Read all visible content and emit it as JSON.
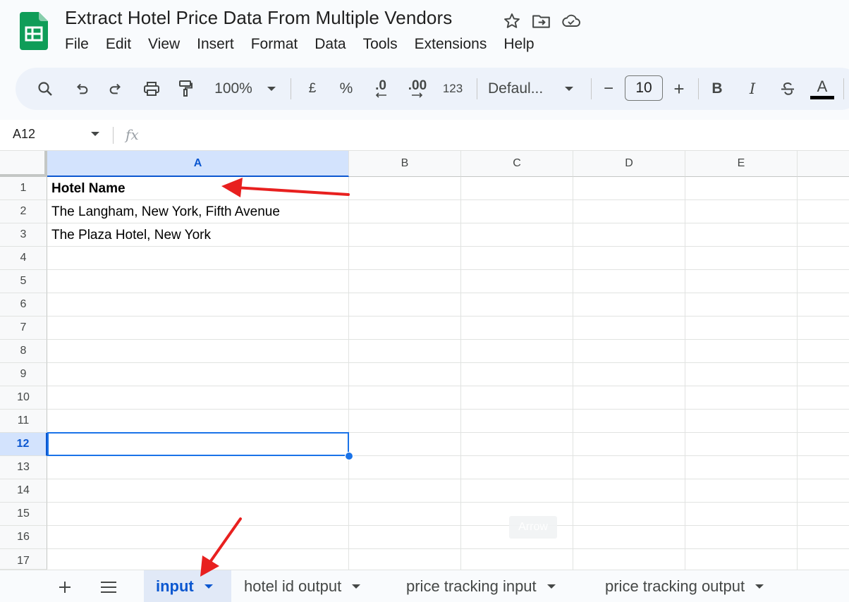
{
  "document": {
    "title": "Extract Hotel Price Data From Multiple Vendors"
  },
  "title_icons": [
    "star-icon",
    "move-folder-icon",
    "cloud-status-icon"
  ],
  "menu": [
    "File",
    "Edit",
    "View",
    "Insert",
    "Format",
    "Data",
    "Tools",
    "Extensions",
    "Help"
  ],
  "toolbar": {
    "zoom": "100%",
    "currency": "£",
    "percent": "%",
    "decrease_decimal": ".0",
    "increase_decimal": ".00",
    "number_format": "123",
    "font": "Defaul...",
    "font_size": "10",
    "minus": "−",
    "plus": "+",
    "bold": "B",
    "italic": "I",
    "text_color": "A"
  },
  "formula_bar": {
    "cell_ref": "A12",
    "fx": "fx",
    "value": ""
  },
  "grid": {
    "columns": [
      "A",
      "B",
      "C",
      "D",
      "E"
    ],
    "rows": [
      "1",
      "2",
      "3",
      "4",
      "5",
      "6",
      "7",
      "8",
      "9",
      "10",
      "11",
      "12",
      "13",
      "14",
      "15",
      "16",
      "17"
    ],
    "selected_column": "A",
    "selected_row": "12",
    "cells": {
      "A1": "Hotel Name",
      "A2": "The Langham, New York, Fifth Avenue",
      "A3": "The Plaza Hotel, New York"
    },
    "watermark": "Arrow"
  },
  "sheet_tabs": [
    {
      "label": "input",
      "active": true
    },
    {
      "label": "hotel id output",
      "active": false
    },
    {
      "label": "price tracking input",
      "active": false
    },
    {
      "label": "price tracking output",
      "active": false
    }
  ],
  "colors": {
    "accent": "#0b57d0",
    "selection": "#1a73e8",
    "annotation_arrow": "#e8201f",
    "logo_green": "#0f9d58"
  }
}
